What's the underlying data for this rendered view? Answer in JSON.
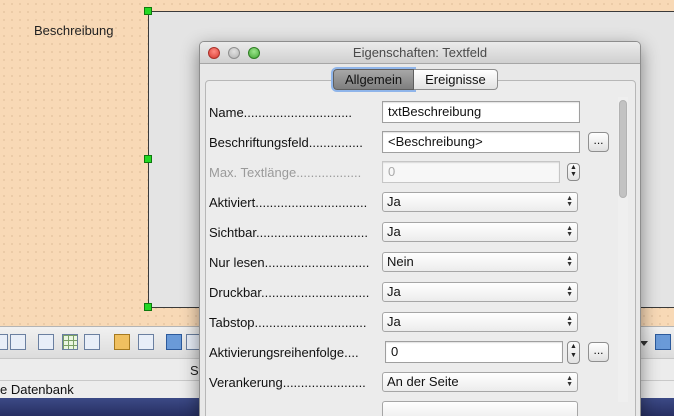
{
  "document": {
    "field_label": "Beschreibung"
  },
  "statusbar": {
    "left_fragment": "St",
    "database_fragment": "e Datenbank"
  },
  "dialog": {
    "title": "Eigenschaften: Textfeld",
    "tabs": [
      {
        "label": "Allgemein",
        "active": true
      },
      {
        "label": "Ereignisse",
        "active": false
      }
    ],
    "properties": [
      {
        "label": "Name..............................",
        "value": "txtBeschreibung",
        "type": "text"
      },
      {
        "label": "Beschriftungsfeld...............",
        "value": "<Beschreibung>",
        "type": "text-button",
        "button": "..."
      },
      {
        "label": "Max. Textlänge..................",
        "value": "0",
        "type": "spinner",
        "disabled": true
      },
      {
        "label": "Aktiviert...............................",
        "value": "Ja",
        "type": "select"
      },
      {
        "label": "Sichtbar...............................",
        "value": "Ja",
        "type": "select"
      },
      {
        "label": "Nur lesen.............................",
        "value": "Nein",
        "type": "select"
      },
      {
        "label": "Druckbar..............................",
        "value": "Ja",
        "type": "select"
      },
      {
        "label": "Tabstop...............................",
        "value": "Ja",
        "type": "select"
      },
      {
        "label": "Aktivierungsreihenfolge....",
        "value": "0",
        "type": "spinner-button",
        "button": "..."
      },
      {
        "label": "Verankerung.......................",
        "value": "An der Seite",
        "type": "select"
      }
    ]
  },
  "icons": {
    "select_arrows": "▴▾",
    "spinner_arrows": "▲▼"
  }
}
